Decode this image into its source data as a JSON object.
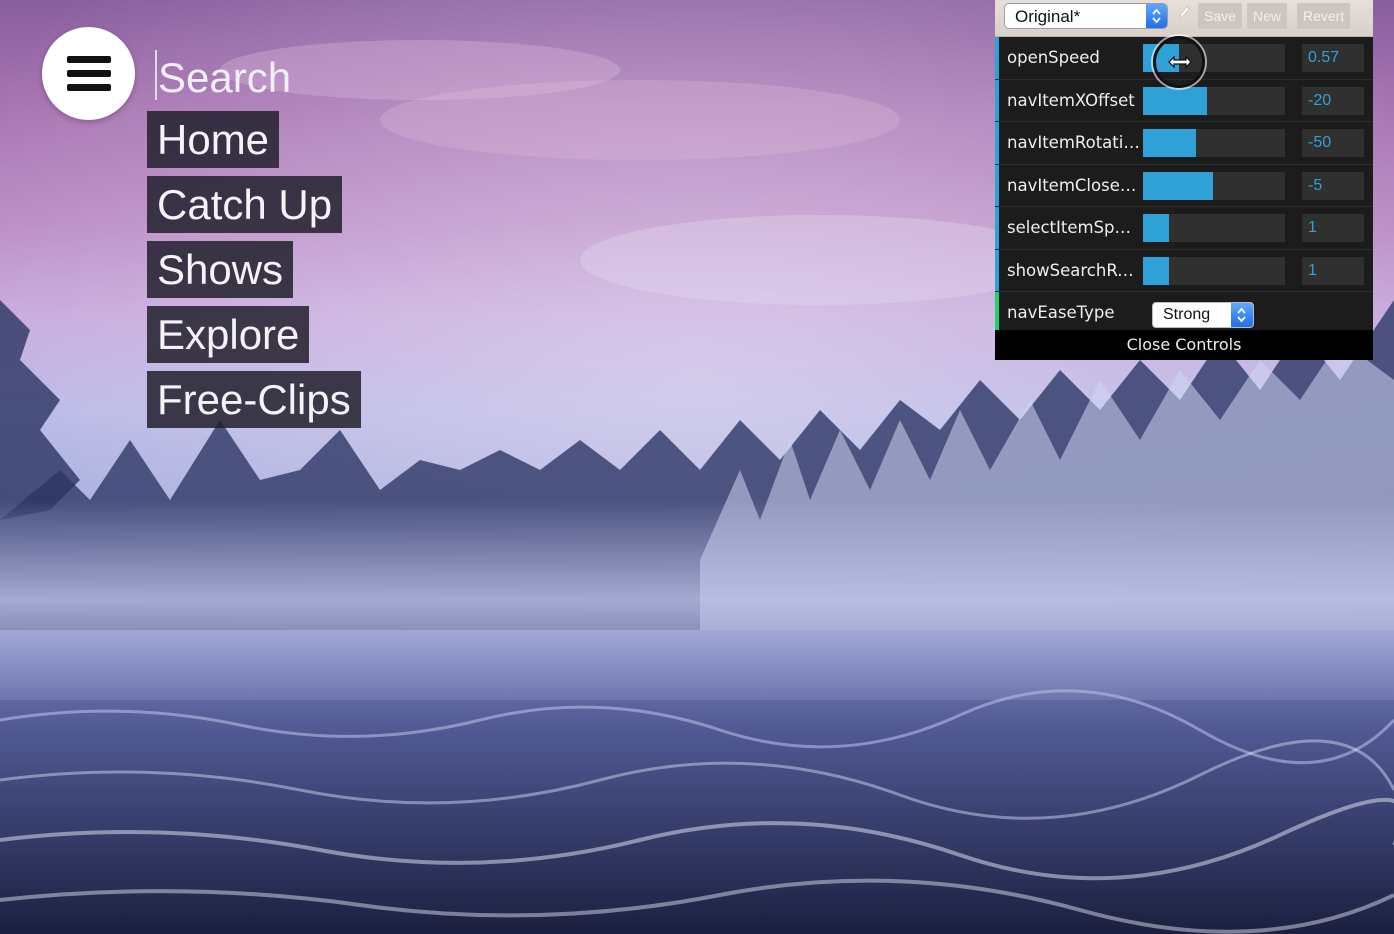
{
  "nav": {
    "search": {
      "placeholder": "Search"
    },
    "items": [
      {
        "label": "Home"
      },
      {
        "label": "Catch Up"
      },
      {
        "label": "Shows"
      },
      {
        "label": "Explore"
      },
      {
        "label": "Free-Clips"
      }
    ]
  },
  "controls": {
    "preset": "Original*",
    "buttons": {
      "save": "Save",
      "new": "New",
      "revert": "Revert"
    },
    "sliders": [
      {
        "label": "openSpeed",
        "value": "0.57",
        "fill_fraction": 0.25
      },
      {
        "label": "navItemXOffset",
        "value": "-20",
        "fill_fraction": 0.45
      },
      {
        "label": "navItemRotation",
        "value": "-50",
        "fill_fraction": 0.37
      },
      {
        "label": "navItemCloseD..",
        "value": "-5",
        "fill_fraction": 0.49
      },
      {
        "label": "selectItemSpeed",
        "value": "1",
        "fill_fraction": 0.18
      },
      {
        "label": "showSearchRes..",
        "value": "1",
        "fill_fraction": 0.18
      }
    ],
    "ease": {
      "label": "navEaseType",
      "value": "Strong"
    },
    "close_label": "Close Controls"
  },
  "colors": {
    "slider_accent": "#2fa1d6",
    "select_accent": "#1ed36f",
    "panel_bg": "#1c1c1c"
  },
  "icons": [
    "hamburger-menu-icon",
    "pencil-icon",
    "select-arrows-icon",
    "resize-horizontal-cursor-icon"
  ]
}
